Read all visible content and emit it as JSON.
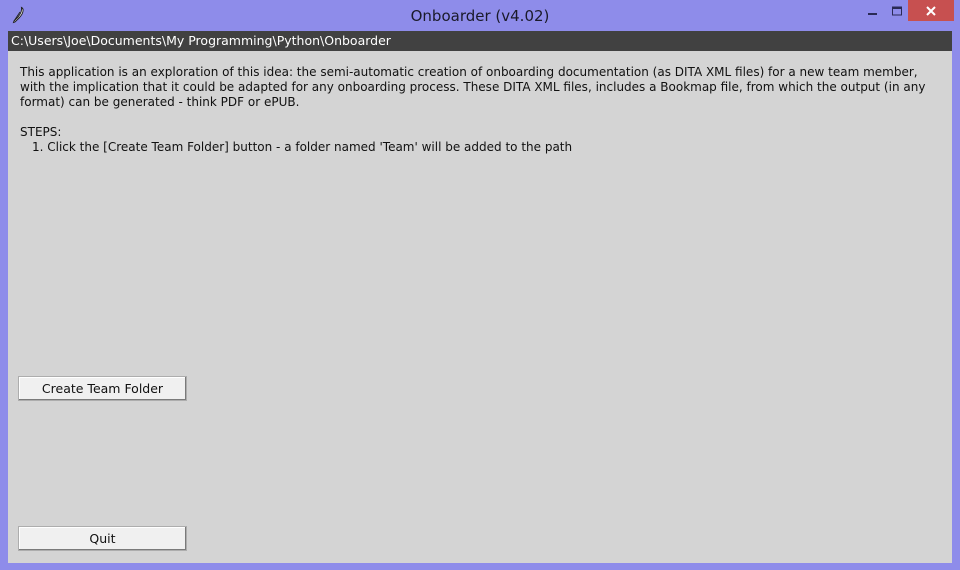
{
  "window": {
    "title": "Onboarder (v4.02)",
    "path": "C:\\Users\\Joe\\Documents\\My Programming\\Python\\Onboarder",
    "controls": {
      "minimize": "minimize",
      "maximize": "maximize",
      "close": "close"
    }
  },
  "content": {
    "description": "This application is an exploration of this idea: the semi-automatic creation of onboarding documentation (as DITA XML files) for a new team member, with the implication that it could be adapted for any onboarding process. These DITA XML files, includes a Bookmap file, from which the output (in any format) can be generated - think PDF or ePUB.",
    "steps_heading": "STEPS:",
    "steps": [
      "1. Click the [Create Team Folder] button - a folder named 'Team' will be added to the path"
    ]
  },
  "buttons": {
    "create_team_folder": "Create Team Folder",
    "quit": "Quit"
  },
  "colors": {
    "titlebar": "#8e8cea",
    "close_button": "#c75050",
    "path_bar": "#414141",
    "client_bg": "#d4d4d4"
  }
}
